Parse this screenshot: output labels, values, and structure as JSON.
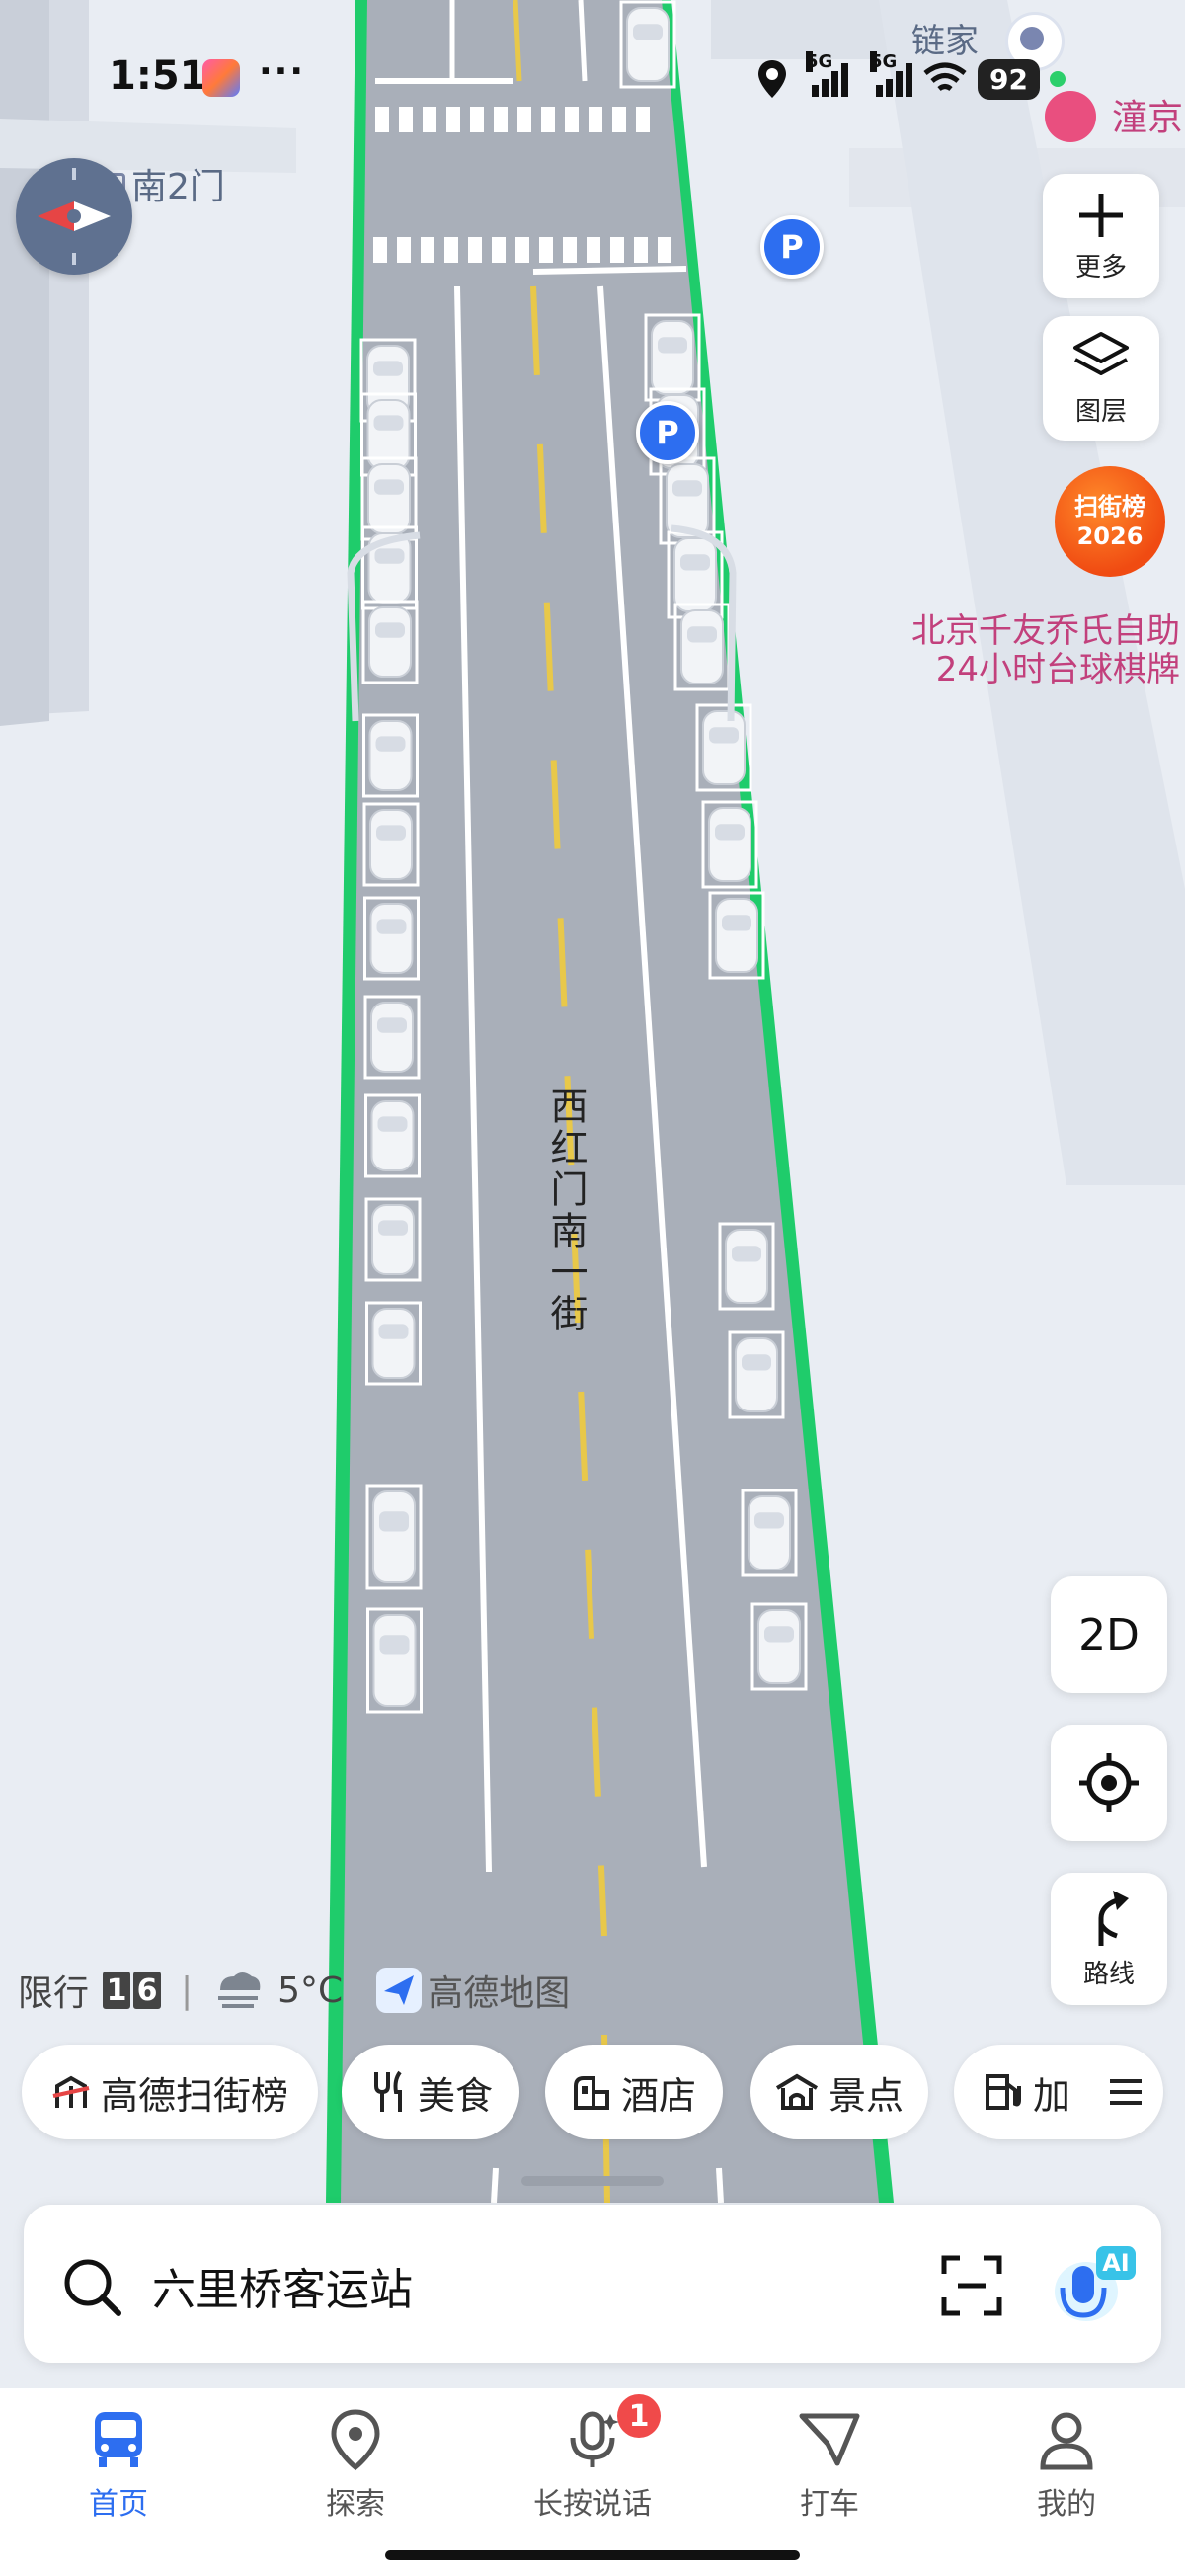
{
  "status_bar": {
    "time": "1:51",
    "more": "···",
    "network_label_1": "5G",
    "network_label_2": "5G",
    "battery": "92"
  },
  "map": {
    "street_name": "西红门南一街",
    "label_gate": "南2门",
    "label_lianjia": "链家",
    "label_tong": "潼京",
    "poi_line_1": "北京千友乔氏自助",
    "poi_line_2": "24小时台球棋牌",
    "parking_symbol": "P"
  },
  "map_controls": {
    "more_label": "更多",
    "layers_label": "图层",
    "promo_line_1": "扫街榜",
    "promo_line_2": "2026",
    "view_mode": "2D",
    "route_label": "路线"
  },
  "info_row": {
    "restriction_label": "限行",
    "restriction_digits": [
      "1",
      "6"
    ],
    "separator": "|",
    "temperature": "5°C",
    "brand": "高德地图"
  },
  "chips": [
    {
      "label": "高德扫街榜",
      "icon": "street-ranking-icon"
    },
    {
      "label": "美食",
      "icon": "fork-knife-icon"
    },
    {
      "label": "酒店",
      "icon": "hotel-icon"
    },
    {
      "label": "景点",
      "icon": "scenic-spot-icon"
    },
    {
      "label": "加",
      "icon": "gas-station-icon"
    }
  ],
  "search": {
    "query": "六里桥客运站"
  },
  "bottom_nav": {
    "items": [
      {
        "label": "首页",
        "icon": "home-bus-icon",
        "active": true
      },
      {
        "label": "探索",
        "icon": "location-pin-icon",
        "active": false
      },
      {
        "label": "长按说话",
        "icon": "microphone-icon",
        "active": false
      },
      {
        "label": "打车",
        "icon": "taxi-icon",
        "active": false
      },
      {
        "label": "我的",
        "icon": "profile-icon",
        "active": false
      }
    ],
    "voice_badge": "1"
  },
  "colors": {
    "accent": "#2d6ef0",
    "road": "#a9afb9",
    "road_edge": "#1fcc6b",
    "center_line": "#e8c84a",
    "poi_pink": "#c2407c",
    "promo_orange": "#f0561a"
  }
}
